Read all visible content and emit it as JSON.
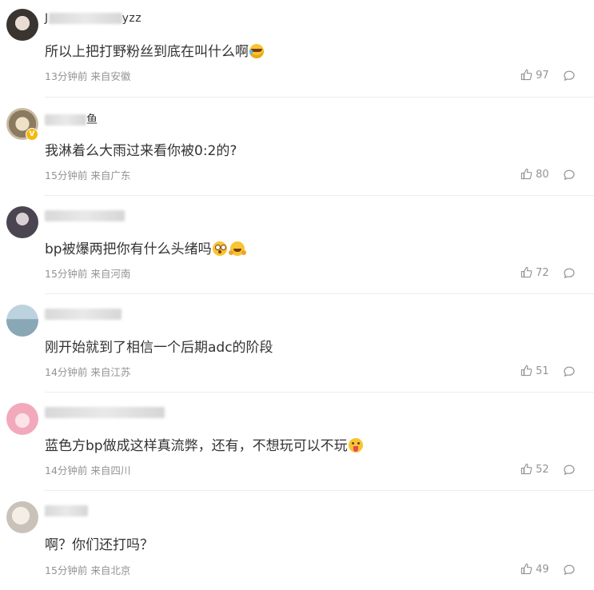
{
  "comments": [
    {
      "username_prefix": "J",
      "username_suffix": "yzz",
      "text": "所以上把打野粉丝到底在叫什么啊",
      "emoji": [
        "laugh-cry-emoji"
      ],
      "meta": "13分钟前 来自安徽",
      "likes": "97",
      "vip": false
    },
    {
      "username_prefix": "",
      "username_suffix": "鱼",
      "text": "我淋着么大雨过来看你被0:2的?",
      "emoji": [],
      "meta": "15分钟前 来自广东",
      "likes": "80",
      "vip": true
    },
    {
      "username_prefix": "",
      "username_suffix": "",
      "text": "bp被爆两把你有什么头绪吗",
      "emoji": [
        "astonished-emoji",
        "hug-emoji"
      ],
      "meta": "15分钟前 来自河南",
      "likes": "72",
      "vip": false
    },
    {
      "username_prefix": "",
      "username_suffix": "",
      "text": "刚开始就到了相信一个后期adc的阶段",
      "emoji": [],
      "meta": "14分钟前 来自江苏",
      "likes": "51",
      "vip": false
    },
    {
      "username_prefix": "",
      "username_suffix": "",
      "text": "蓝色方bp做成这样真流弊，还有，不想玩可以不玩",
      "emoji": [
        "tongue-emoji"
      ],
      "meta": "14分钟前 来自四川",
      "likes": "52",
      "vip": false
    },
    {
      "username_prefix": "",
      "username_suffix": "",
      "text": "啊？你们还打吗？",
      "emoji": [],
      "meta": "15分钟前 来自北京",
      "likes": "49",
      "vip": false
    }
  ],
  "colors": {
    "text": "#333333",
    "meta": "#939393",
    "divider": "#ededed",
    "vip_badge": "#f5b90f"
  },
  "icons": {
    "like": "thumbs-up-icon",
    "reply": "comment-bubble-icon"
  }
}
